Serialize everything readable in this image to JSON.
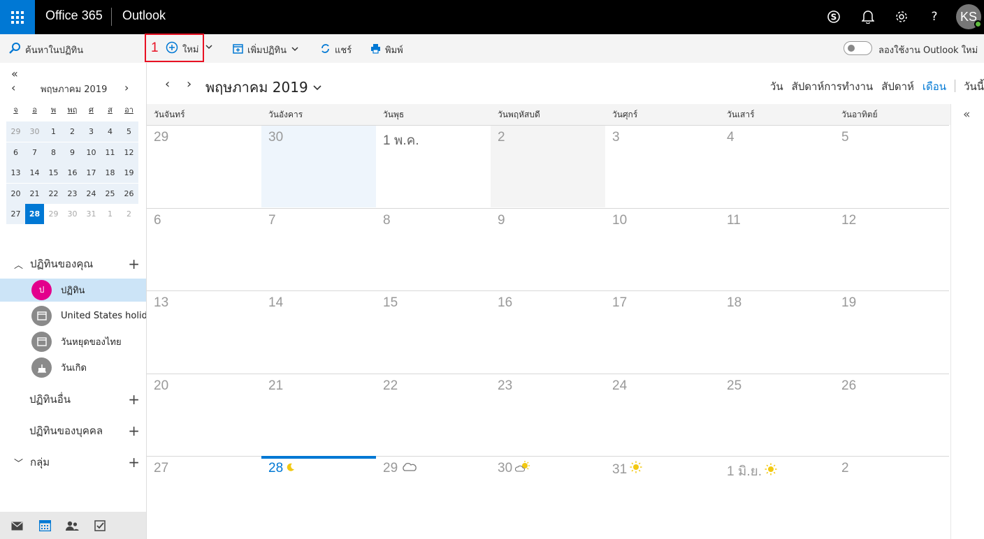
{
  "topbar": {
    "brand": "Office 365",
    "app": "Outlook",
    "icons": [
      "app-launcher-icon",
      "skype-icon",
      "bell-icon",
      "gear-icon",
      "help-icon"
    ],
    "help": "?",
    "avatar_initials": "KS",
    "bg": "#000000",
    "accent": "#0078d4"
  },
  "commandbar": {
    "search_label": "ค้นหาในปฏิทิน",
    "step_number": "1",
    "new_label": "ใหม่",
    "add_calendar_label": "เพิ่มปฏิทิน",
    "share_label": "แชร์",
    "print_label": "พิมพ์",
    "try_new_label": "ลองใช้งาน Outlook ใหม่",
    "try_new_enabled": false
  },
  "minical": {
    "title": "พฤษภาคม 2019",
    "weekdays": [
      "จ",
      "อ",
      "พ",
      "พฤ",
      "ศ",
      "ส",
      "อา"
    ],
    "weeks": [
      [
        "29",
        "30",
        "1",
        "2",
        "3",
        "4",
        "5"
      ],
      [
        "6",
        "7",
        "8",
        "9",
        "10",
        "11",
        "12"
      ],
      [
        "13",
        "14",
        "15",
        "16",
        "17",
        "18",
        "19"
      ],
      [
        "20",
        "21",
        "22",
        "23",
        "24",
        "25",
        "26"
      ],
      [
        "27",
        "28",
        "29",
        "30",
        "31",
        "1",
        "2"
      ]
    ],
    "selected": "28"
  },
  "sidebar": {
    "my_calendars": "ปฏิทินของคุณ",
    "calendars": [
      {
        "label": "ปฏิทิน",
        "initial": "ป",
        "color": "#e3008c",
        "selected": true
      },
      {
        "label": "United States holidays",
        "initial": "",
        "color": "#8a8a8a",
        "selected": false
      },
      {
        "label": "วันหยุดของไทย",
        "initial": "",
        "color": "#8a8a8a",
        "selected": false
      },
      {
        "label": "วันเกิด",
        "initial": "",
        "color": "#8a8a8a",
        "selected": false
      }
    ],
    "other_calendars": "ปฏิทินอื่น",
    "people_calendars": "ปฏิทินของบุคคล",
    "groups": "กลุ่ม"
  },
  "main": {
    "month_title": "พฤษภาคม 2019",
    "views": {
      "day": "วัน",
      "workweek": "สัปดาห์การทำงาน",
      "week": "สัปดาห์",
      "month": "เดือน",
      "today": "วันนี้"
    },
    "active_view": "month",
    "weekday_headers": [
      "วันจันทร์",
      "วันอังคาร",
      "วันพุธ",
      "วันพฤหัสบดี",
      "วันศุกร์",
      "วันเสาร์",
      "วันอาทิตย์"
    ],
    "weeks": [
      [
        "29",
        "30",
        "1 พ.ค.",
        "2",
        "3",
        "4",
        "5"
      ],
      [
        "6",
        "7",
        "8",
        "9",
        "10",
        "11",
        "12"
      ],
      [
        "13",
        "14",
        "15",
        "16",
        "17",
        "18",
        "19"
      ],
      [
        "20",
        "21",
        "22",
        "23",
        "24",
        "25",
        "26"
      ],
      [
        "27",
        "28",
        "29",
        "30",
        "31",
        "1 มิ.ย.",
        "2"
      ]
    ],
    "weather": {
      "28": "moon-icon",
      "29": "cloud-icon",
      "30": "partly-sunny-icon",
      "31": "sun-icon",
      "1 มิ.ย.": "sun-icon"
    },
    "today": "28"
  }
}
